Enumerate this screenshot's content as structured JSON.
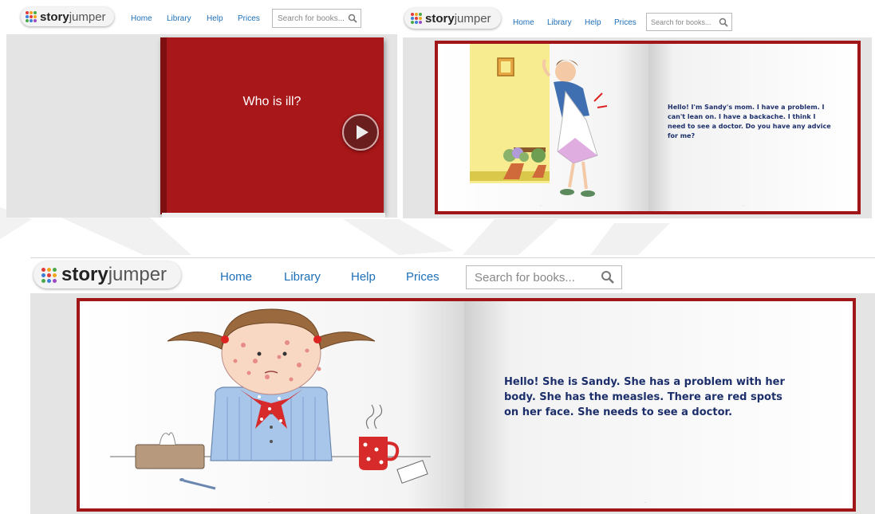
{
  "nav": {
    "logo_story": "story",
    "logo_jumper": "jumper",
    "home": "Home",
    "library": "Library",
    "help": "Help",
    "prices": "Prices",
    "search_placeholder": "Search for books..."
  },
  "screen1": {
    "cover_title": "Who is ill?"
  },
  "screen2": {
    "page_text": "Hello! I'm Sandy's mom. I have a problem. I can't lean on. I have a backache. I think I need to see a doctor. Do you have any advice for me?"
  },
  "screen3": {
    "page_text": "Hello! She is Sandy. She has a problem with her body. She has the measles. There are red spots on her face. She needs to see a doctor."
  },
  "colors": {
    "book_red": "#a11618",
    "nav_link": "#1d6fb8",
    "story_text": "#1c2f6b"
  }
}
